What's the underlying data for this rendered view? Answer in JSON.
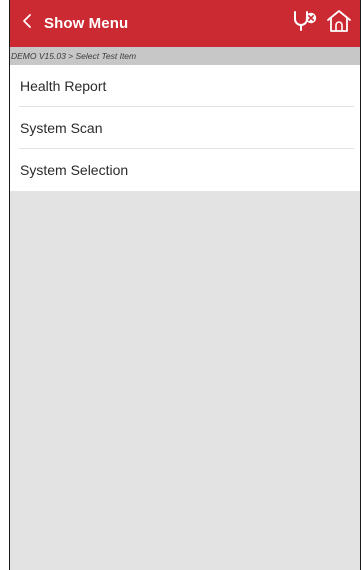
{
  "header": {
    "title": "Show Menu",
    "back_icon": "chevron-left-icon",
    "diagnose_icon": "stethoscope-icon",
    "home_icon": "home-icon",
    "background": "#cc2a33"
  },
  "breadcrumb": {
    "text": "DEMO V15.03 > Select Test Item"
  },
  "menu": {
    "items": [
      {
        "label": "Health Report"
      },
      {
        "label": "System Scan"
      },
      {
        "label": "System Selection"
      }
    ]
  }
}
